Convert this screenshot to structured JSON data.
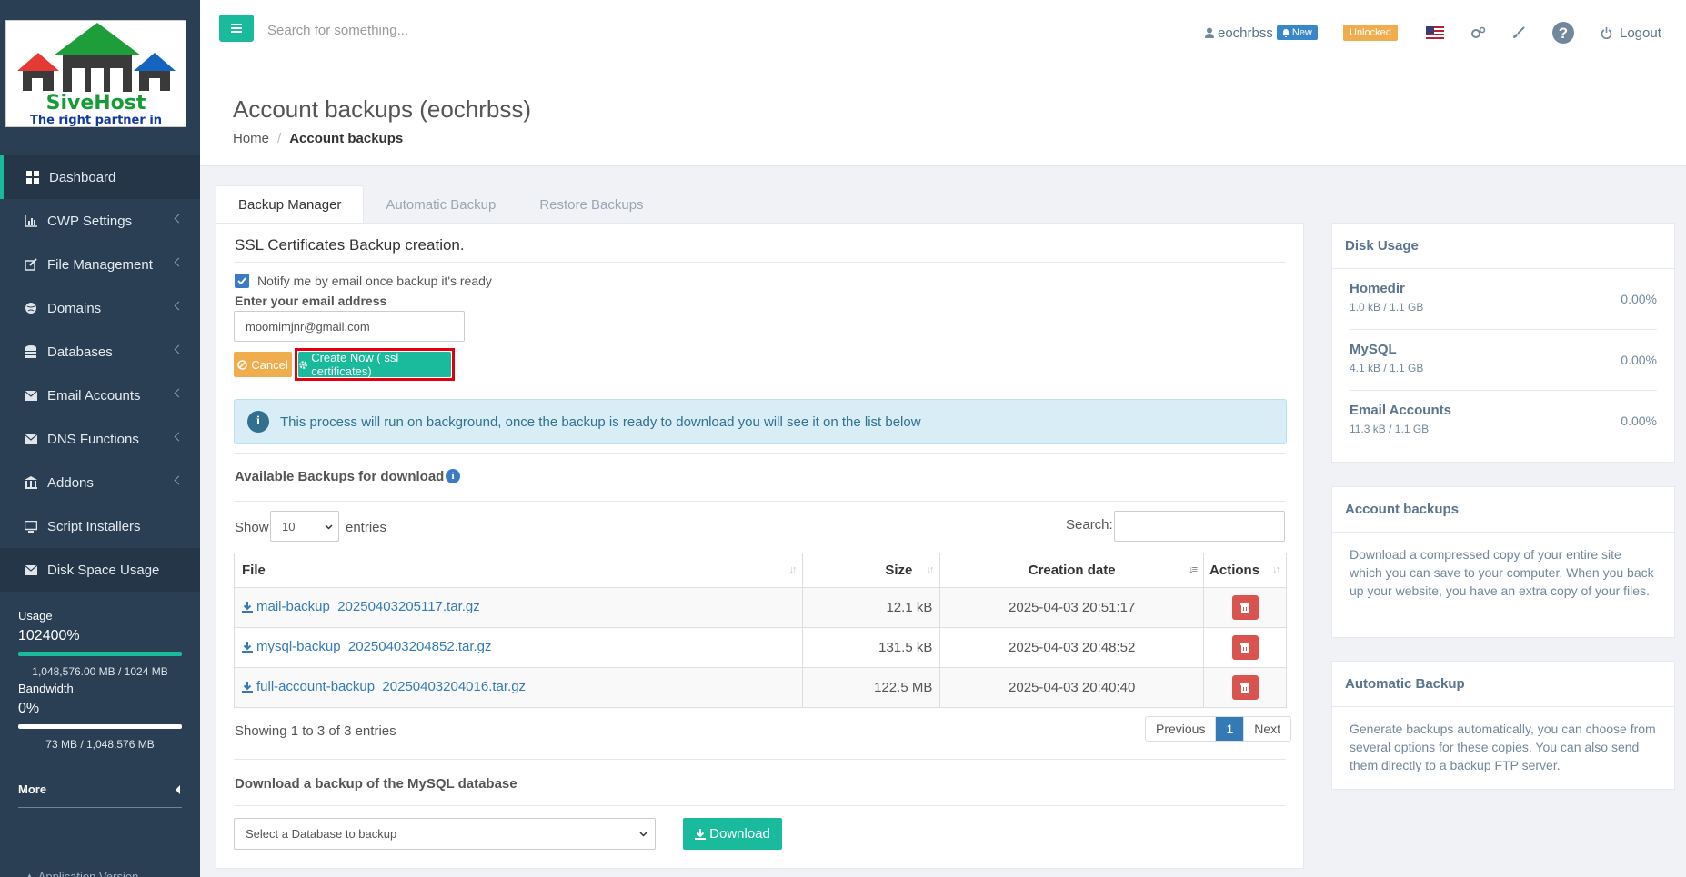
{
  "brand": {
    "name": "SiveHost",
    "tagline": "The right partner in hosting"
  },
  "sidebar": {
    "items": [
      {
        "label": "Dashboard",
        "icon": "dashboard-icon"
      },
      {
        "label": "CWP Settings",
        "icon": "chart-icon"
      },
      {
        "label": "File Management",
        "icon": "edit-icon"
      },
      {
        "label": "Domains",
        "icon": "globe-icon"
      },
      {
        "label": "Databases",
        "icon": "database-icon"
      },
      {
        "label": "Email Accounts",
        "icon": "envelope-icon"
      },
      {
        "label": "DNS Functions",
        "icon": "envelope-icon"
      },
      {
        "label": "Addons",
        "icon": "bank-icon"
      },
      {
        "label": "Script Installers",
        "icon": "monitor-icon"
      },
      {
        "label": "Disk Space Usage",
        "icon": "envelope-icon"
      }
    ],
    "usage": {
      "label": "Usage",
      "value": "102400%",
      "detail": "1,048,576.00 MB / 1024 MB",
      "fill_fraction": 1.0
    },
    "bandwidth": {
      "label": "Bandwidth",
      "value": "0%",
      "detail": "73 MB / 1,048,576 MB",
      "fill_fraction": 0.0
    },
    "more_label": "More",
    "app_version_label": "Application Version"
  },
  "topbar": {
    "search_placeholder": "Search for something...",
    "username": "eochrbss",
    "new_badge": "New",
    "unlocked_badge": "Unlocked",
    "logout_label": "Logout"
  },
  "page": {
    "title": "Account backups (eochrbss)",
    "breadcrumb_home": "Home",
    "breadcrumb_current": "Account backups"
  },
  "tabs": [
    "Backup Manager",
    "Automatic Backup",
    "Restore Backups"
  ],
  "backup_form": {
    "title": "SSL Certificates Backup creation.",
    "notify_label": "Notify me by email once backup it's ready",
    "email_label": "Enter your email address",
    "email_value": "moomimjnr@gmail.com",
    "cancel_label": "Cancel",
    "create_label": "Create Now ( ssl certificates)",
    "alert_text": "This process will run on background, once the backup is ready to download you will see it on the list below"
  },
  "backups": {
    "title": "Available Backups for download",
    "show_label": "Show",
    "entries_label": "entries",
    "page_size": "10",
    "search_label": "Search:",
    "columns": [
      "File",
      "Size",
      "Creation date",
      "Actions"
    ],
    "rows": [
      {
        "file": "mail-backup_20250403205117.tar.gz",
        "size": "12.1 kB",
        "date": "2025-04-03 20:51:17"
      },
      {
        "file": "mysql-backup_20250403204852.tar.gz",
        "size": "131.5 kB",
        "date": "2025-04-03 20:48:52"
      },
      {
        "file": "full-account-backup_20250403204016.tar.gz",
        "size": "122.5 MB",
        "date": "2025-04-03 20:40:40"
      }
    ],
    "info": "Showing 1 to 3 of 3 entries",
    "pager": {
      "prev": "Previous",
      "current": "1",
      "next": "Next"
    }
  },
  "mysql": {
    "title": "Download a backup of the MySQL database",
    "select_placeholder": "Select a Database to backup",
    "download_label": "Download"
  },
  "disk_usage": {
    "title": "Disk Usage",
    "rows": [
      {
        "name": "Homedir",
        "detail": "1.0 kB / 1.1 GB",
        "pct": "0.00%"
      },
      {
        "name": "MySQL",
        "detail": "4.1 kB / 1.1 GB",
        "pct": "0.00%"
      },
      {
        "name": "Email Accounts",
        "detail": "11.3 kB / 1.1 GB",
        "pct": "0.00%"
      }
    ]
  },
  "info_panels": {
    "account_backups": {
      "title": "Account backups",
      "text": "Download a compressed copy of your entire site which you can save to your computer. When you back up your website, you have an extra copy of your files."
    },
    "automatic_backup": {
      "title": "Automatic Backup",
      "text": "Generate backups automatically, you can choose from several options for these copies. You can also send them directly to a backup FTP server."
    }
  },
  "colors": {
    "accent": "#1abb9c",
    "sidebar": "#2a3f54",
    "danger": "#d9534f",
    "warning": "#f0ad4e",
    "link": "#337ab7",
    "highlight": "#e0000e"
  }
}
